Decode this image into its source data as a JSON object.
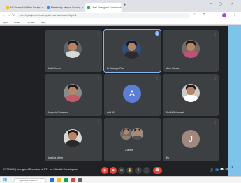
{
  "browser": {
    "tabs": [
      {
        "label": "Ms.Prerna & Vidisha Design",
        "color": "#fbbc04"
      },
      {
        "label": "Mentorship Integral Tutoring",
        "color": "#4285f4"
      },
      {
        "label": "Meet - Inaugural Function of",
        "color": "#34a853"
      }
    ],
    "new_tab": "+",
    "tab_close": "×",
    "window_controls": {
      "minimize": "–",
      "maximize": "▢",
      "close": "×"
    },
    "url": "meet.google.com/mue-qmkp-nuu?authuser=1&pli=1",
    "nav": {
      "back": "←",
      "forward": "→",
      "reload": "↻"
    },
    "bookmarks": [
      "Apps",
      "Gmail",
      "YouTube",
      "Maps"
    ]
  },
  "participants": [
    {
      "name": "Sushil Kumar",
      "type": "photo",
      "bg": "#5f6368",
      "shirt": "#d8d8d8"
    },
    {
      "name": "Dr. Manager Rao",
      "type": "photo",
      "bg": "#2f4f7a",
      "shirt": "#2b2b2b",
      "speaking": true,
      "badge": "⋮"
    },
    {
      "name": "Manu Vidisha",
      "type": "photo",
      "bg": "#7a6a66",
      "shirt": "#c0507a"
    },
    {
      "name": "Sangeeta Srivastava",
      "type": "photo",
      "bg": "#8a8a8a",
      "shirt": "#c35a6a"
    },
    {
      "name": "Aditi 12",
      "type": "letter",
      "letter": "A",
      "color": "#5b7fd6"
    },
    {
      "name": "Shruthi Shivanand",
      "type": "photo",
      "bg": "#cfc9c5",
      "shirt": "#ffffff"
    },
    {
      "name": "Angelika Meher",
      "type": "photo",
      "bg": "#d7d7d7",
      "shirt": "#2a2a2a"
    },
    {
      "name": "2 others",
      "type": "group"
    },
    {
      "name": "Jhu",
      "type": "letter",
      "letter": "J",
      "color": "#a1887f"
    }
  ],
  "tile_menu": "⋮",
  "meeting": {
    "time": "11:25 AM",
    "separator": "|",
    "title": "Inaugural Function of STL on Mindful Developme..."
  },
  "controls": [
    {
      "name": "mic-off-button",
      "icon": "◉",
      "red": true
    },
    {
      "name": "camera-off-button",
      "icon": "■",
      "red": true
    },
    {
      "name": "captions-button",
      "icon": "▭",
      "red": false
    },
    {
      "name": "raise-hand-button",
      "icon": "✋",
      "red": false
    },
    {
      "name": "present-button",
      "icon": "⇧",
      "red": false
    },
    {
      "name": "more-options-button",
      "icon": "⋮",
      "red": false
    },
    {
      "name": "leave-call-button",
      "icon": "☎",
      "red": true,
      "end": true
    }
  ],
  "right_controls": [
    {
      "name": "info-icon",
      "icon": "ⓘ"
    },
    {
      "name": "people-icon",
      "icon": "👥"
    },
    {
      "name": "chat-icon",
      "icon": "💬"
    },
    {
      "name": "activities-icon",
      "icon": "⚙"
    }
  ],
  "people_count": "9",
  "taskbar": {
    "search_placeholder": "Type here to search",
    "start_icon": "⊞",
    "icons": [
      "#1a73e8",
      "#fbbc04",
      "#0f9d58",
      "#ea4335",
      "#5f6368"
    ]
  }
}
